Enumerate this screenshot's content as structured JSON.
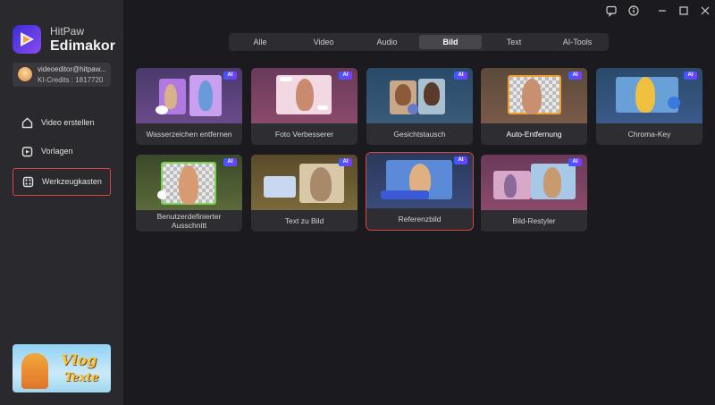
{
  "app": {
    "brand_small": "HitPaw",
    "brand_big": "Edimakor"
  },
  "account": {
    "email": "videoeditor@hitpaw...",
    "credits": "KI-Credits : 1817720"
  },
  "nav": [
    {
      "label": "Video erstellen",
      "icon": "home-icon"
    },
    {
      "label": "Vorlagen",
      "icon": "play-icon"
    },
    {
      "label": "Werkzeugkasten",
      "icon": "toolbox-icon"
    }
  ],
  "promo": {
    "line1": "Vlog",
    "line2": "Texte"
  },
  "tabs": [
    {
      "label": "Alle"
    },
    {
      "label": "Video"
    },
    {
      "label": "Audio"
    },
    {
      "label": "Bild"
    },
    {
      "label": "Text"
    },
    {
      "label": "AI-Tools"
    }
  ],
  "cards": [
    {
      "label": "Wasserzeichen entfernen",
      "ai": "AI"
    },
    {
      "label": "Foto Verbesserer",
      "ai": "AI"
    },
    {
      "label": "Gesichtstausch",
      "ai": "AI"
    },
    {
      "label": "Auto-Entfernung",
      "ai": "AI"
    },
    {
      "label": "Chroma-Key",
      "ai": "AI"
    },
    {
      "label": "Benutzerdefinierter Ausschnitt",
      "ai": "AI"
    },
    {
      "label": "Text zu Bild",
      "ai": "AI"
    },
    {
      "label": "Referenzbild",
      "ai": "AI"
    },
    {
      "label": "Bild-Restyler",
      "ai": "AI"
    }
  ],
  "colors": {
    "accent_selection": "#e04040",
    "background": "#1b1b1f",
    "sidebar": "#2a2a2e",
    "ai_badge": "#5a4cff"
  }
}
